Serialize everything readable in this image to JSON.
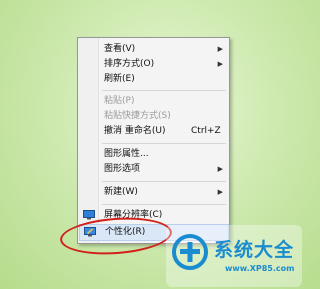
{
  "context_menu": {
    "items": [
      {
        "label": "查看(V)",
        "shortcut": "",
        "submenu": true,
        "disabled": false
      },
      {
        "label": "排序方式(O)",
        "shortcut": "",
        "submenu": true,
        "disabled": false
      },
      {
        "label": "刷新(E)",
        "shortcut": "",
        "submenu": false,
        "disabled": false
      },
      {
        "label": "粘贴(P)",
        "shortcut": "",
        "submenu": false,
        "disabled": true
      },
      {
        "label": "粘贴快捷方式(S)",
        "shortcut": "",
        "submenu": false,
        "disabled": true
      },
      {
        "label": "撤消 重命名(U)",
        "shortcut": "Ctrl+Z",
        "submenu": false,
        "disabled": false
      },
      {
        "label": "图形属性...",
        "shortcut": "",
        "submenu": false,
        "disabled": false
      },
      {
        "label": "图形选项",
        "shortcut": "",
        "submenu": true,
        "disabled": false
      },
      {
        "label": "新建(W)",
        "shortcut": "",
        "submenu": true,
        "disabled": false
      },
      {
        "label": "屏幕分辨率(C)",
        "shortcut": "",
        "submenu": false,
        "disabled": false,
        "icon": "screen-resolution-icon"
      },
      {
        "label": "个性化(R)",
        "shortcut": "",
        "submenu": false,
        "disabled": false,
        "icon": "personalize-icon",
        "highlighted": true
      }
    ],
    "arrow_glyph": "▶"
  },
  "annotation": {
    "color": "#d2201a"
  },
  "watermark": {
    "title": "系统大全",
    "url": "www.XP85.com",
    "logo": "xp85-logo",
    "color": "#1a8ccf"
  }
}
